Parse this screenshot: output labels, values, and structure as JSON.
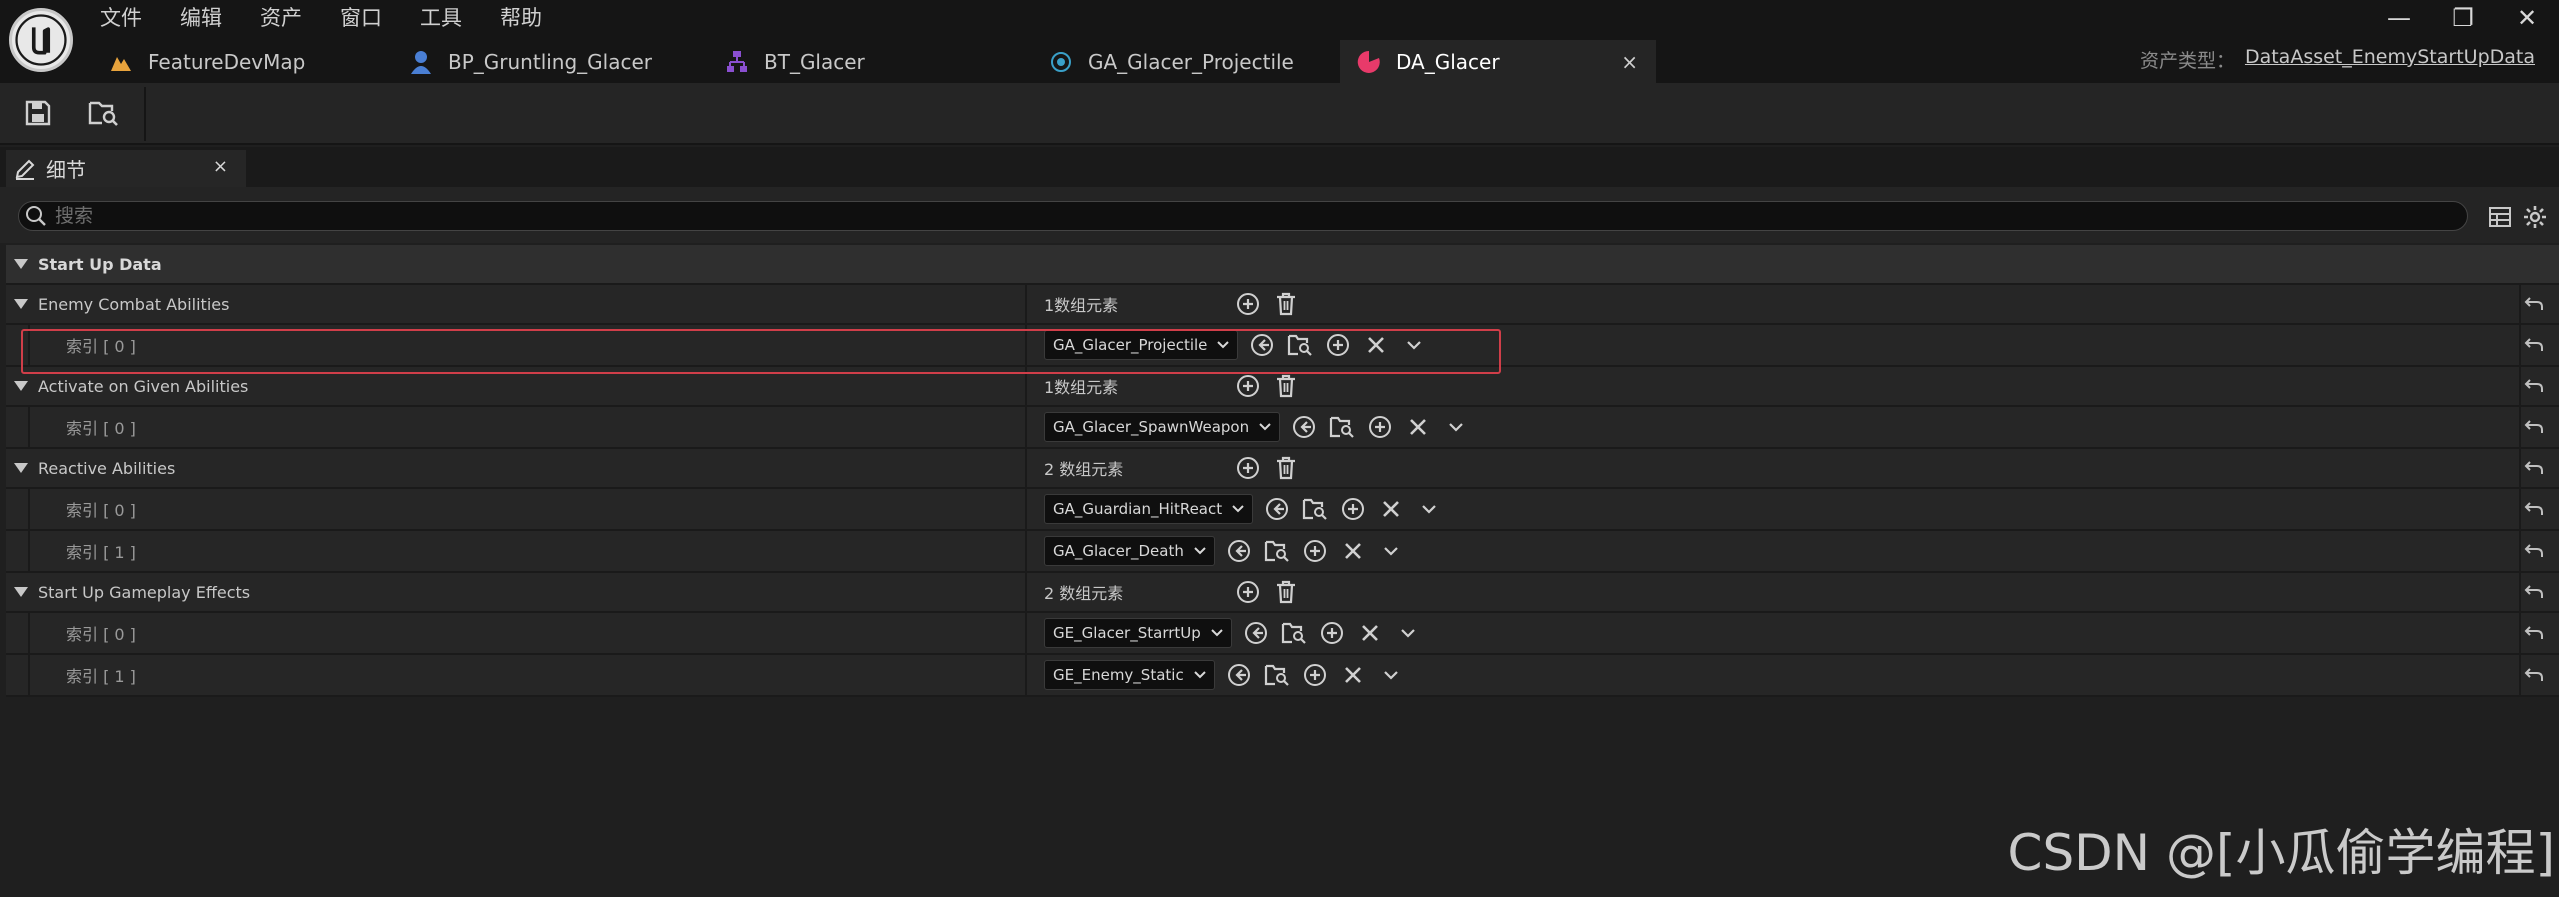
{
  "menu": [
    "文件",
    "编辑",
    "资产",
    "窗口",
    "工具",
    "帮助"
  ],
  "window_controls": {
    "minimize": "—",
    "restore": "❐",
    "close": "✕"
  },
  "tabs": [
    {
      "label": "FeatureDevMap",
      "icon": "map-icon",
      "color": "#e8a33c"
    },
    {
      "label": "BP_Gruntling_Glacer",
      "icon": "blueprint-pawn-icon",
      "color": "#4a7fd4"
    },
    {
      "label": "BT_Glacer",
      "icon": "behavior-tree-icon",
      "color": "#8a4fd0"
    },
    {
      "label": "GA_Glacer_Projectile",
      "icon": "gameplay-ability-icon",
      "color": "#3aa0c8"
    },
    {
      "label": "DA_Glacer",
      "icon": "data-asset-icon",
      "color": "#e83a6a",
      "active": true,
      "close": "×"
    }
  ],
  "asset_type": {
    "label": "资产类型：",
    "value": "DataAsset_EnemyStartUpData"
  },
  "details": {
    "tab_label": "细节",
    "tab_close": "×",
    "search_placeholder": "搜索",
    "section": "Start Up Data",
    "groups": [
      {
        "name": "Enemy Combat Abilities",
        "count": "1数组元素",
        "items": [
          {
            "index": "索引 [ 0 ]",
            "value": "GA_Glacer_Projectile"
          }
        ]
      },
      {
        "name": "Activate on Given Abilities",
        "count": "1数组元素",
        "items": [
          {
            "index": "索引 [ 0 ]",
            "value": "GA_Glacer_SpawnWeapon"
          }
        ]
      },
      {
        "name": "Reactive Abilities",
        "count": "2 数组元素",
        "items": [
          {
            "index": "索引 [ 0 ]",
            "value": "GA_Guardian_HitReact"
          },
          {
            "index": "索引 [ 1 ]",
            "value": "GA_Glacer_Death"
          }
        ]
      },
      {
        "name": "Start Up Gameplay Effects",
        "count": "2 数组元素",
        "items": [
          {
            "index": "索引 [ 0 ]",
            "value": "GE_Glacer_StarrtUp"
          },
          {
            "index": "索引 [ 1 ]",
            "value": "GE_Enemy_Static"
          }
        ]
      }
    ]
  },
  "colors": {
    "highlight": "#d03e49",
    "accent_blue": "#4a7fd4"
  },
  "watermark": "CSDN @[小瓜偷学编程]"
}
